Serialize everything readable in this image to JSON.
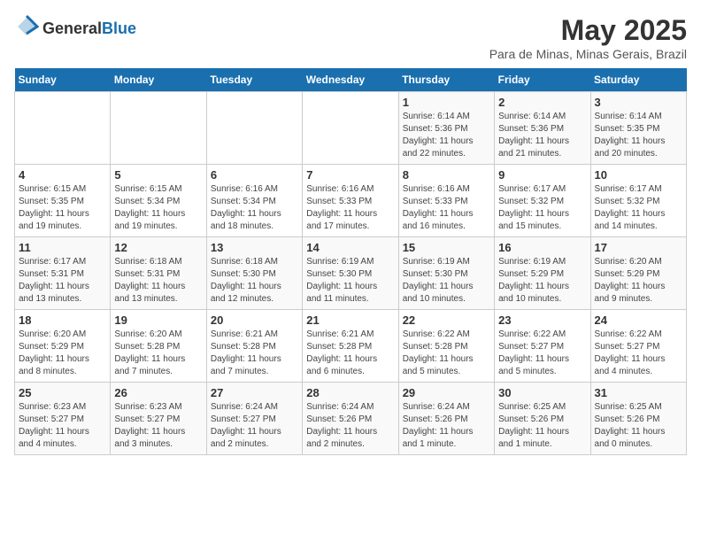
{
  "header": {
    "logo_general": "General",
    "logo_blue": "Blue",
    "month_title": "May 2025",
    "subtitle": "Para de Minas, Minas Gerais, Brazil"
  },
  "days_of_week": [
    "Sunday",
    "Monday",
    "Tuesday",
    "Wednesday",
    "Thursday",
    "Friday",
    "Saturday"
  ],
  "weeks": [
    [
      {
        "day": "",
        "info": ""
      },
      {
        "day": "",
        "info": ""
      },
      {
        "day": "",
        "info": ""
      },
      {
        "day": "",
        "info": ""
      },
      {
        "day": "1",
        "info": "Sunrise: 6:14 AM\nSunset: 5:36 PM\nDaylight: 11 hours\nand 22 minutes."
      },
      {
        "day": "2",
        "info": "Sunrise: 6:14 AM\nSunset: 5:36 PM\nDaylight: 11 hours\nand 21 minutes."
      },
      {
        "day": "3",
        "info": "Sunrise: 6:14 AM\nSunset: 5:35 PM\nDaylight: 11 hours\nand 20 minutes."
      }
    ],
    [
      {
        "day": "4",
        "info": "Sunrise: 6:15 AM\nSunset: 5:35 PM\nDaylight: 11 hours\nand 19 minutes."
      },
      {
        "day": "5",
        "info": "Sunrise: 6:15 AM\nSunset: 5:34 PM\nDaylight: 11 hours\nand 19 minutes."
      },
      {
        "day": "6",
        "info": "Sunrise: 6:16 AM\nSunset: 5:34 PM\nDaylight: 11 hours\nand 18 minutes."
      },
      {
        "day": "7",
        "info": "Sunrise: 6:16 AM\nSunset: 5:33 PM\nDaylight: 11 hours\nand 17 minutes."
      },
      {
        "day": "8",
        "info": "Sunrise: 6:16 AM\nSunset: 5:33 PM\nDaylight: 11 hours\nand 16 minutes."
      },
      {
        "day": "9",
        "info": "Sunrise: 6:17 AM\nSunset: 5:32 PM\nDaylight: 11 hours\nand 15 minutes."
      },
      {
        "day": "10",
        "info": "Sunrise: 6:17 AM\nSunset: 5:32 PM\nDaylight: 11 hours\nand 14 minutes."
      }
    ],
    [
      {
        "day": "11",
        "info": "Sunrise: 6:17 AM\nSunset: 5:31 PM\nDaylight: 11 hours\nand 13 minutes."
      },
      {
        "day": "12",
        "info": "Sunrise: 6:18 AM\nSunset: 5:31 PM\nDaylight: 11 hours\nand 13 minutes."
      },
      {
        "day": "13",
        "info": "Sunrise: 6:18 AM\nSunset: 5:30 PM\nDaylight: 11 hours\nand 12 minutes."
      },
      {
        "day": "14",
        "info": "Sunrise: 6:19 AM\nSunset: 5:30 PM\nDaylight: 11 hours\nand 11 minutes."
      },
      {
        "day": "15",
        "info": "Sunrise: 6:19 AM\nSunset: 5:30 PM\nDaylight: 11 hours\nand 10 minutes."
      },
      {
        "day": "16",
        "info": "Sunrise: 6:19 AM\nSunset: 5:29 PM\nDaylight: 11 hours\nand 10 minutes."
      },
      {
        "day": "17",
        "info": "Sunrise: 6:20 AM\nSunset: 5:29 PM\nDaylight: 11 hours\nand 9 minutes."
      }
    ],
    [
      {
        "day": "18",
        "info": "Sunrise: 6:20 AM\nSunset: 5:29 PM\nDaylight: 11 hours\nand 8 minutes."
      },
      {
        "day": "19",
        "info": "Sunrise: 6:20 AM\nSunset: 5:28 PM\nDaylight: 11 hours\nand 7 minutes."
      },
      {
        "day": "20",
        "info": "Sunrise: 6:21 AM\nSunset: 5:28 PM\nDaylight: 11 hours\nand 7 minutes."
      },
      {
        "day": "21",
        "info": "Sunrise: 6:21 AM\nSunset: 5:28 PM\nDaylight: 11 hours\nand 6 minutes."
      },
      {
        "day": "22",
        "info": "Sunrise: 6:22 AM\nSunset: 5:28 PM\nDaylight: 11 hours\nand 5 minutes."
      },
      {
        "day": "23",
        "info": "Sunrise: 6:22 AM\nSunset: 5:27 PM\nDaylight: 11 hours\nand 5 minutes."
      },
      {
        "day": "24",
        "info": "Sunrise: 6:22 AM\nSunset: 5:27 PM\nDaylight: 11 hours\nand 4 minutes."
      }
    ],
    [
      {
        "day": "25",
        "info": "Sunrise: 6:23 AM\nSunset: 5:27 PM\nDaylight: 11 hours\nand 4 minutes."
      },
      {
        "day": "26",
        "info": "Sunrise: 6:23 AM\nSunset: 5:27 PM\nDaylight: 11 hours\nand 3 minutes."
      },
      {
        "day": "27",
        "info": "Sunrise: 6:24 AM\nSunset: 5:27 PM\nDaylight: 11 hours\nand 2 minutes."
      },
      {
        "day": "28",
        "info": "Sunrise: 6:24 AM\nSunset: 5:26 PM\nDaylight: 11 hours\nand 2 minutes."
      },
      {
        "day": "29",
        "info": "Sunrise: 6:24 AM\nSunset: 5:26 PM\nDaylight: 11 hours\nand 1 minute."
      },
      {
        "day": "30",
        "info": "Sunrise: 6:25 AM\nSunset: 5:26 PM\nDaylight: 11 hours\nand 1 minute."
      },
      {
        "day": "31",
        "info": "Sunrise: 6:25 AM\nSunset: 5:26 PM\nDaylight: 11 hours\nand 0 minutes."
      }
    ]
  ]
}
